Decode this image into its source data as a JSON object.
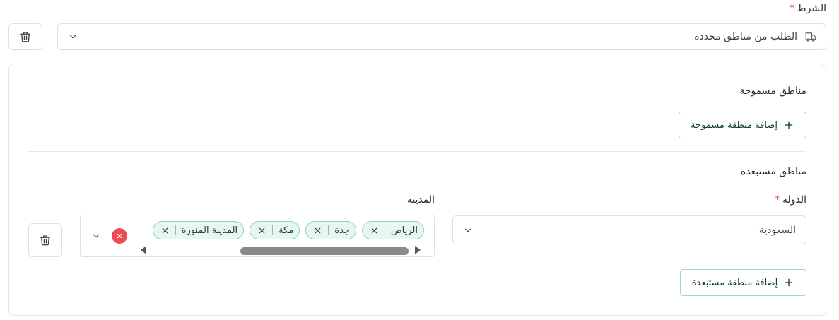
{
  "condition": {
    "label": "الشرط",
    "required_mark": "*",
    "selected_value": "الطلب من مناطق محددة",
    "icon": "truck-icon"
  },
  "allowed": {
    "title": "مناطق مسموحة",
    "add_label": "إضافة منطقة مسموحة"
  },
  "excluded": {
    "title": "مناطق مستبعدة",
    "country_label": "الدولة",
    "required_mark": "*",
    "country_value": "السعودية",
    "city_label": "المدينة",
    "cities": [
      "الرياض",
      "جدة",
      "مكة",
      "المدينة المنورة"
    ],
    "add_label": "إضافة منطقة مستبعدة"
  },
  "colors": {
    "accent_border": "#9fd9c8",
    "tag_bg": "#e6f7f1",
    "tag_border": "#8fd3bd",
    "required": "#e5484d",
    "clear": "#ef4b57"
  }
}
